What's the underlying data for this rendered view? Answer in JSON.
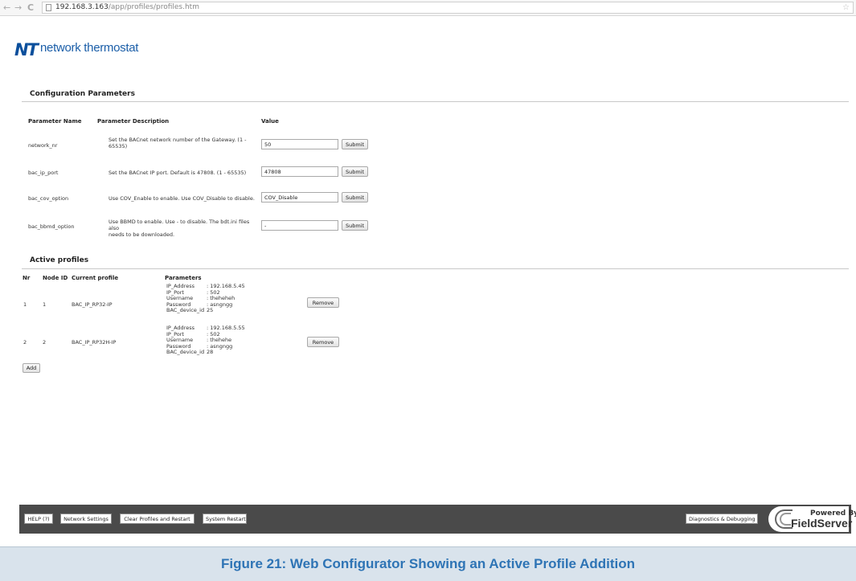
{
  "browser": {
    "reload_icon": "C",
    "url_host": "192.168.3.163",
    "url_path": "/app/profiles/profiles.htm"
  },
  "logo": {
    "mark": "NT",
    "text": "network thermostat"
  },
  "config": {
    "title": "Configuration Parameters",
    "headers": {
      "name": "Parameter Name",
      "description": "Parameter Description",
      "value": "Value"
    },
    "rows": [
      {
        "name": "network_nr",
        "desc_line1": "Set the BACnet network number of the Gateway. (1 -",
        "desc_line2": "65535)",
        "value": "50",
        "button": "Submit"
      },
      {
        "name": "bac_ip_port",
        "desc_line1": "Set the BACnet IP port. Default is 47808. (1 - 65535)",
        "desc_line2": "",
        "value": "47808",
        "button": "Submit"
      },
      {
        "name": "bac_cov_option",
        "desc_line1": "Use COV_Enable to enable. Use COV_Disable to disable.",
        "desc_line2": "",
        "value": "COV_Disable",
        "button": "Submit"
      },
      {
        "name": "bac_bbmd_option",
        "desc_line1": "Use BBMD to enable. Use - to disable. The bdt.ini files also",
        "desc_line2": "needs to be downloaded.",
        "value": "-",
        "button": "Submit"
      }
    ]
  },
  "profiles": {
    "title": "Active profiles",
    "headers": {
      "nr": "Nr",
      "node_id": "Node ID",
      "current_profile": "Current profile",
      "parameters": "Parameters"
    },
    "rows": [
      {
        "nr": "1",
        "node_id": "1",
        "profile": "BAC_IP_RP32-IP",
        "params": [
          {
            "k": "IP_Address",
            "v": ": 192.168.5.45"
          },
          {
            "k": "IP_Port",
            "v": ": 502"
          },
          {
            "k": "Username",
            "v": ": theheheh"
          },
          {
            "k": "Password",
            "v": ": asngngg"
          },
          {
            "k": "BAC_device_id",
            "v": "25"
          }
        ],
        "button": "Remove"
      },
      {
        "nr": "2",
        "node_id": "2",
        "profile": "BAC_IP_RP32H-IP",
        "params": [
          {
            "k": "IP_Address",
            "v": ": 192.168.5.55"
          },
          {
            "k": "IP_Port",
            "v": ": 502"
          },
          {
            "k": "Username",
            "v": ": thehehe"
          },
          {
            "k": "Password",
            "v": ": asngngg"
          },
          {
            "k": "BAC_device_id",
            "v": "28"
          }
        ],
        "button": "Remove"
      }
    ],
    "add_button": "Add"
  },
  "footer": {
    "help": "HELP (?)",
    "network_settings": "Network Settings",
    "clear_profiles": "Clear Profiles and Restart",
    "system_restart": "System Restart",
    "diagnostics": "Diagnostics & Debugging",
    "powered_by": "Powered By",
    "brand": "FieldServer"
  },
  "caption": "Figure 21: Web Configurator Showing an Active Profile Addition",
  "colors": {
    "caption_text": "#2e74b5",
    "caption_bg": "#d9e3ec",
    "footer_bg": "#4a4a4a",
    "logo_blue": "#1b5ea8"
  }
}
